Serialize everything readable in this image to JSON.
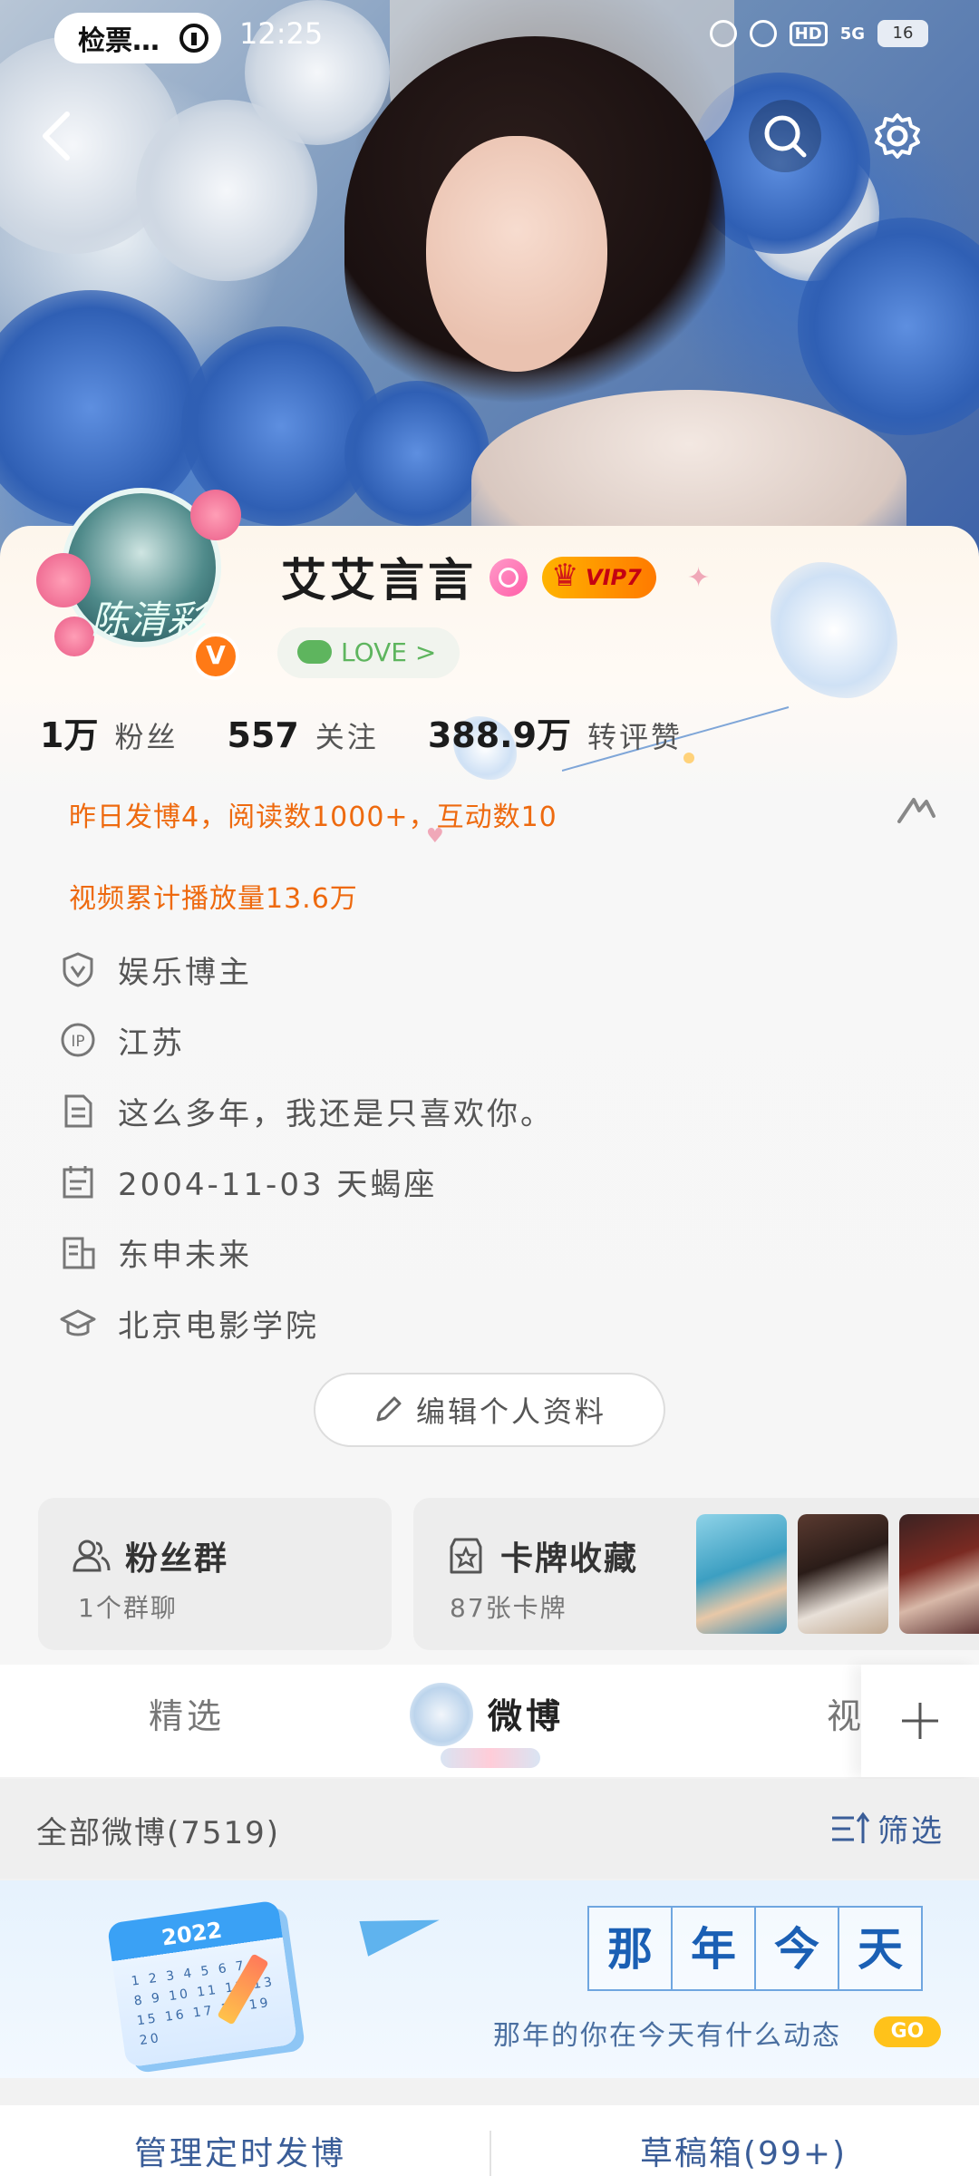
{
  "status_bar": {
    "notification": "检票…",
    "time": "12:25",
    "hd": "HD",
    "signal": "5G",
    "battery": "16"
  },
  "profile": {
    "username": "艾艾言言",
    "vip": "VIP7",
    "love_pill": "LOVE >",
    "verified_mark": "V",
    "avatar_signature": "陈清彩",
    "stats": [
      {
        "value": "1万",
        "label": "粉丝"
      },
      {
        "value": "557",
        "label": "关注"
      },
      {
        "value": "388.9万",
        "label": "转评赞"
      }
    ],
    "summary_line1": "昨日发博4，阅读数1000+，互动数10",
    "summary_line2": "视频累计播放量13.6万",
    "info": [
      {
        "icon": "verified-shield-icon",
        "text": "娱乐博主"
      },
      {
        "icon": "ip-location-icon",
        "text": "江苏"
      },
      {
        "icon": "bio-document-icon",
        "text": "这么多年，我还是只喜欢你。"
      },
      {
        "icon": "calendar-icon",
        "text": "2004-11-03 天蝎座"
      },
      {
        "icon": "company-icon",
        "text": "东申未来"
      },
      {
        "icon": "graduation-cap-icon",
        "text": "北京电影学院"
      }
    ],
    "edit_button": "编辑个人资料"
  },
  "cards": {
    "fans_group_title": "粉丝群",
    "fans_group_sub": "1个群聊",
    "card_collection_title": "卡牌收藏",
    "card_collection_sub": "87张卡牌"
  },
  "tabs": [
    {
      "label": "精选",
      "active": false
    },
    {
      "label": "微博",
      "active": true
    },
    {
      "label": "视",
      "active": false
    }
  ],
  "feed": {
    "all_posts": "全部微博(7519)",
    "filter": "筛选"
  },
  "banner": {
    "title_chars": [
      "那",
      "年",
      "今",
      "天"
    ],
    "subtitle": "那年的你在今天有什么动态",
    "go": "GO",
    "calendar_year": "2022",
    "calendar_days": "1 2 3 4 5 6 7|8 9 10 11 12 13|15 16 17 18 19 20"
  },
  "bottom": {
    "scheduled": "管理定时发博",
    "drafts": "草稿箱(99+)"
  },
  "colors": {
    "accent_orange": "#ee6a0f",
    "link_blue": "#3a5d98",
    "vip_gold": "#ffb300",
    "love_green": "#5eb55e"
  }
}
